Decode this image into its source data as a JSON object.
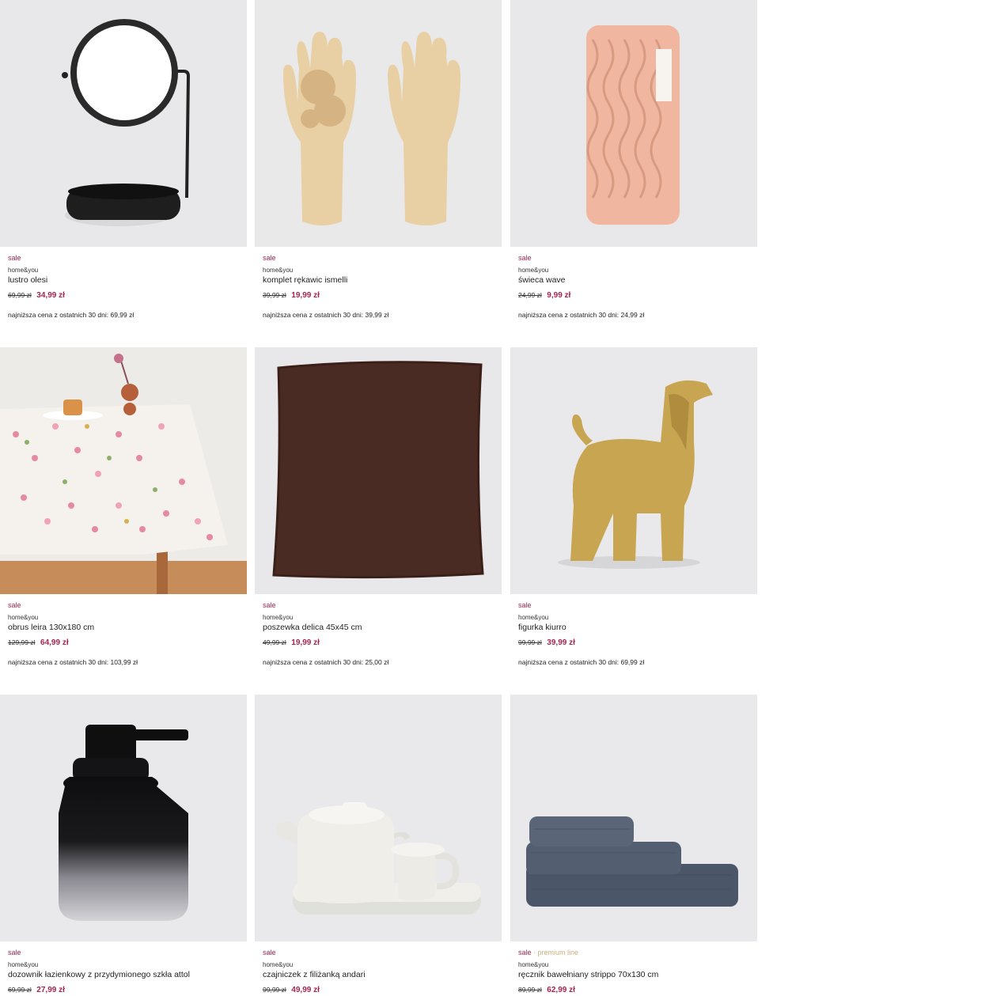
{
  "products": [
    {
      "sale": "sale",
      "brand": "home&you",
      "name": "lustro olesi",
      "old_price": "69,99 zł",
      "new_price": "34,99 zł",
      "lowest": "najniższa cena z ostatnich 30 dni: 69,99 zł",
      "image": "mirror"
    },
    {
      "sale": "sale",
      "brand": "home&you",
      "name": "komplet rękawic ismelli",
      "old_price": "39,99 zł",
      "new_price": "19,99 zł",
      "lowest": "najniższa cena z ostatnich 30 dni: 39,99 zł",
      "image": "gloves"
    },
    {
      "sale": "sale",
      "brand": "home&you",
      "name": "świeca wave",
      "old_price": "24,99 zł",
      "new_price": "9,99 zł",
      "lowest": "najniższa cena z ostatnich 30 dni: 24,99 zł",
      "image": "candle"
    },
    {
      "sale": "sale",
      "brand": "home&you",
      "name": "obrus leira 130x180 cm",
      "old_price": "129,99 zł",
      "new_price": "64,99 zł",
      "lowest": "najniższa cena z ostatnich 30 dni: 103,99 zł",
      "image": "tablecloth"
    },
    {
      "sale": "sale",
      "brand": "home&you",
      "name": "poszewka delica 45x45 cm",
      "old_price": "49,99 zł",
      "new_price": "19,99 zł",
      "lowest": "najniższa cena z ostatnich 30 dni: 25,00 zł",
      "image": "pillow"
    },
    {
      "sale": "sale",
      "brand": "home&you",
      "name": "figurka kiurro",
      "old_price": "99,99 zł",
      "new_price": "39,99 zł",
      "lowest": "najniższa cena z ostatnich 30 dni: 69,99 zł",
      "image": "dog-figurine"
    },
    {
      "sale": "sale",
      "brand": "home&you",
      "name": "dozownik łazienkowy z przydymionego szkła attol",
      "old_price": "69,99 zł",
      "new_price": "27,99 zł",
      "lowest": "",
      "image": "soap-dispenser"
    },
    {
      "sale": "sale",
      "brand": "home&you",
      "name": "czajniczek z filiżanką andari",
      "old_price": "99,99 zł",
      "new_price": "49,99 zł",
      "lowest": "",
      "image": "teapot"
    },
    {
      "sale": "sale",
      "premium": "premium line",
      "brand": "home&you",
      "name": "ręcznik bawełniany strippo 70x130 cm",
      "old_price": "89,99 zł",
      "new_price": "62,99 zł",
      "lowest": "",
      "image": "towels"
    }
  ],
  "colors": {
    "sale": "#a2264e",
    "premium": "#c8b17d",
    "photo_bg": "#e9e9eb"
  },
  "separators": {
    "premium": "·"
  }
}
